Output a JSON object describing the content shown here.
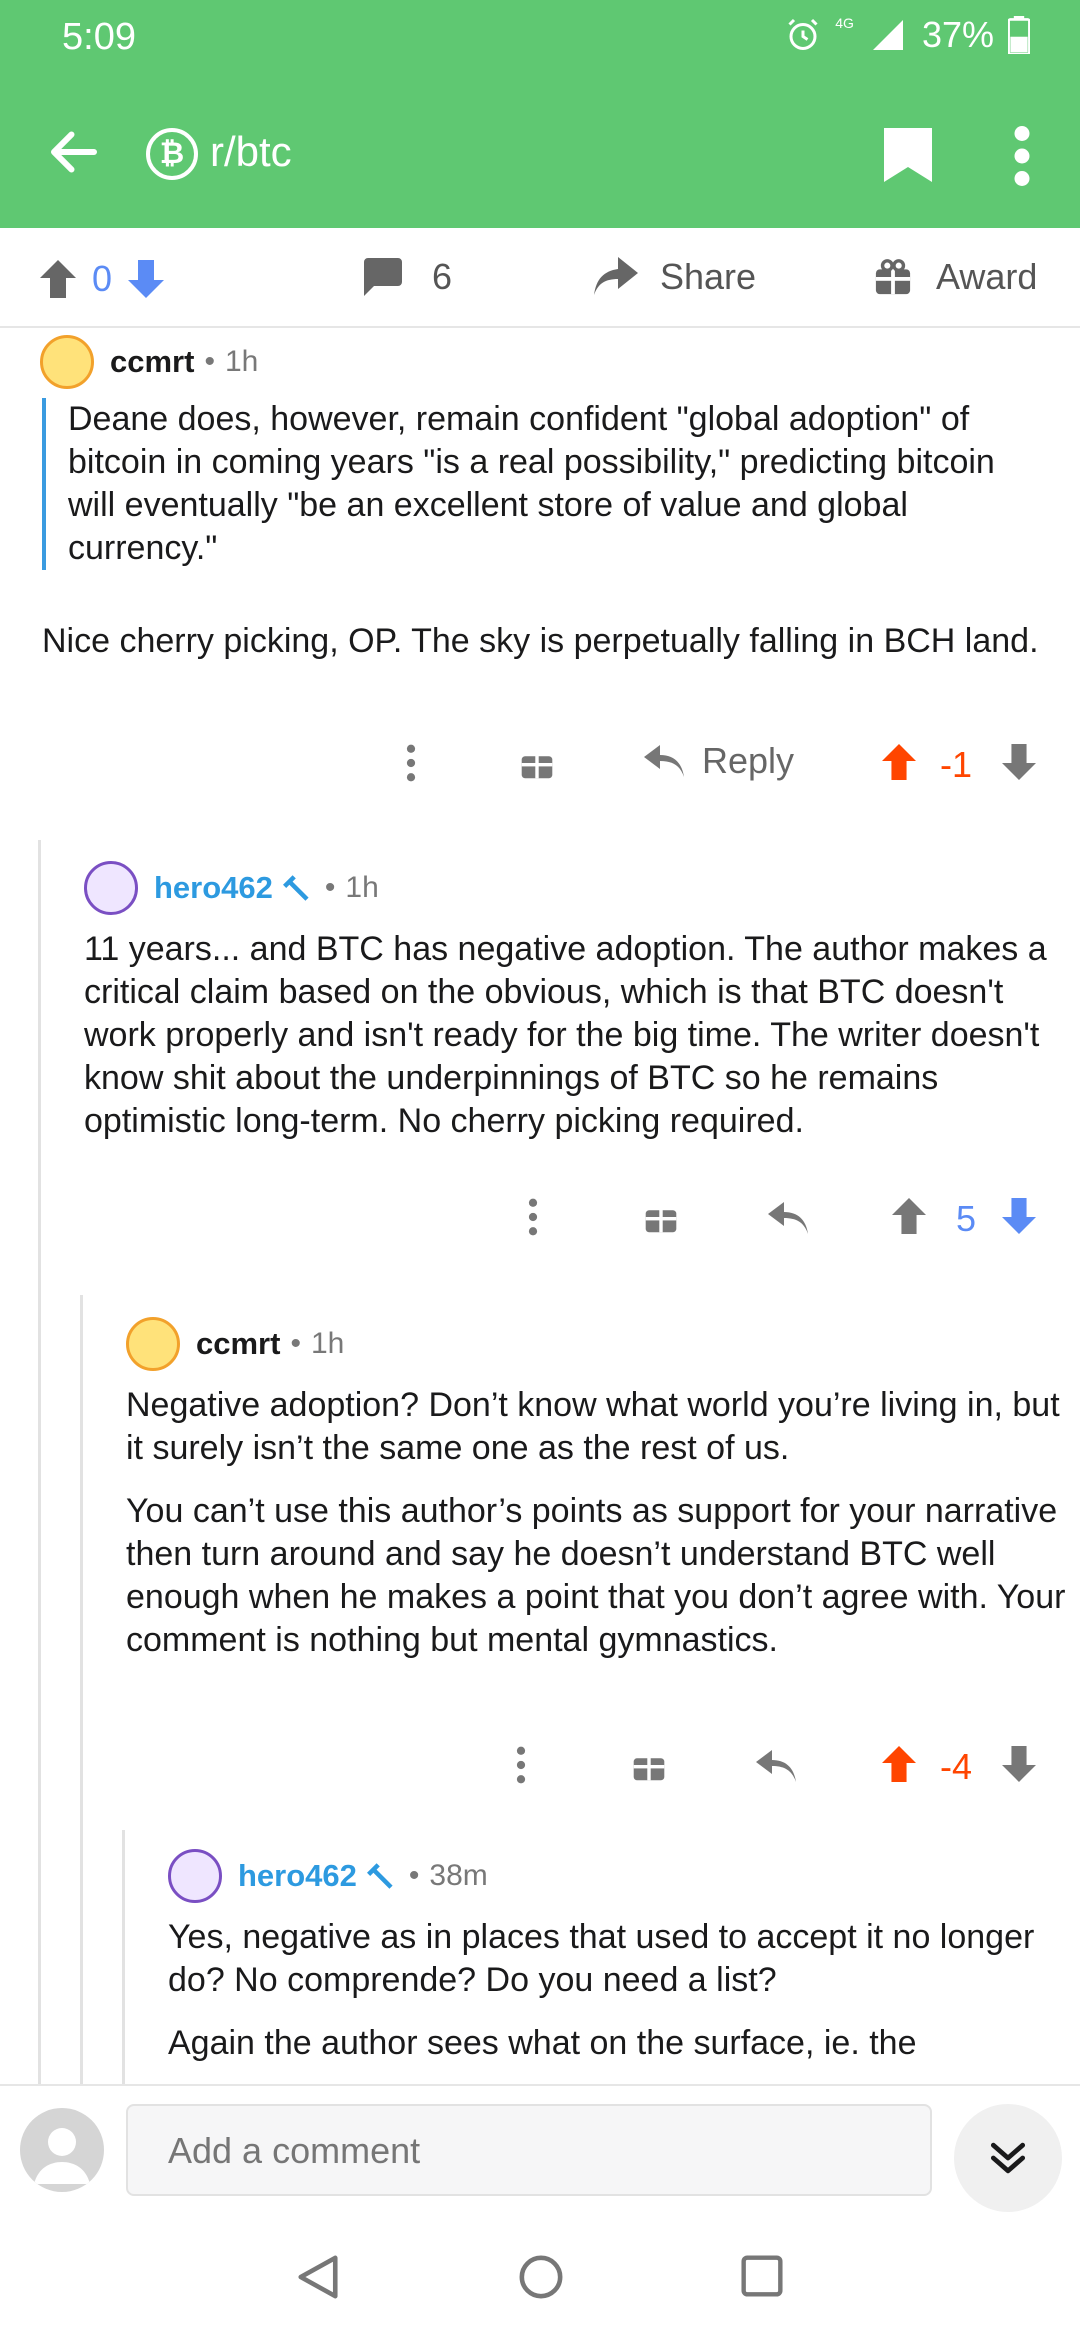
{
  "status": {
    "time": "5:09",
    "network": "4G",
    "battery": "37%"
  },
  "header": {
    "subreddit": "r/btc",
    "sub_icon_letter": "₿"
  },
  "actionbar": {
    "votes": "0",
    "comments": "6",
    "share": "Share",
    "award": "Award"
  },
  "comments": [
    {
      "author": "ccmrt",
      "time": "1h",
      "quote": "Deane does, however, remain confident \"global adoption\" of bitcoin in coming years \"is a real possibility,\" predicting bitcoin will eventually \"be an excellent store of value and global currency.\"",
      "body": "Nice cherry picking, OP. The sky is perpetually falling  in BCH land.",
      "reply_label": "Reply",
      "score": "-1"
    },
    {
      "author": "hero462",
      "time": "1h",
      "body": "11 years...  and BTC has negative adoption.  The author makes a critical claim based on the obvious, which is that BTC doesn't work properly and isn't ready for the big time.  The writer doesn't know shit about the underpinnings of BTC so he remains optimistic long-term.  No cherry picking required.",
      "score": "5"
    },
    {
      "author": "ccmrt",
      "time": "1h",
      "body1": "Negative adoption? Don’t know what world you’re living in, but it surely isn’t the same one as the rest of us.",
      "body2": "You can’t use this author’s points as support for your narrative then turn around and say he doesn’t understand BTC well enough when he makes a point that you don’t agree with. Your comment is nothing but mental gymnastics.",
      "score": "-4"
    },
    {
      "author": "hero462",
      "time": "38m",
      "body1": "Yes, negative as in places that used to accept it no longer do?  No comprende?  Do you need a list?",
      "body2": "Again the author sees what on the surface, ie. the"
    }
  ],
  "composer": {
    "placeholder": "Add a comment"
  },
  "colors": {
    "brand": "#5fc872",
    "upvote": "#ff4500",
    "downvote": "#5b8bf5",
    "link": "#2d9ae0",
    "quote_bar": "#3a9be0"
  }
}
